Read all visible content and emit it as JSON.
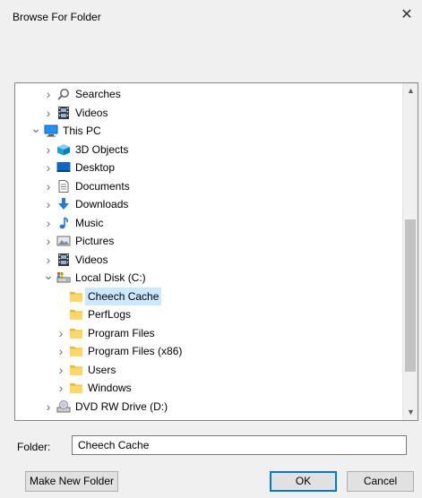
{
  "dialog": {
    "title": "Browse For Folder",
    "close_glyph": "✕"
  },
  "tree": {
    "items": [
      {
        "label": "Searches",
        "icon": "search-icon",
        "level": 1,
        "expander": "collapsed"
      },
      {
        "label": "Videos",
        "icon": "film-icon",
        "level": 1,
        "expander": "collapsed"
      },
      {
        "label": "This PC",
        "icon": "computer-icon",
        "level": 0,
        "expander": "expanded"
      },
      {
        "label": "3D Objects",
        "icon": "cube-icon",
        "level": 1,
        "expander": "collapsed"
      },
      {
        "label": "Desktop",
        "icon": "desktop-icon",
        "level": 1,
        "expander": "collapsed"
      },
      {
        "label": "Documents",
        "icon": "document-icon",
        "level": 1,
        "expander": "collapsed"
      },
      {
        "label": "Downloads",
        "icon": "download-icon",
        "level": 1,
        "expander": "collapsed"
      },
      {
        "label": "Music",
        "icon": "music-note-icon",
        "level": 1,
        "expander": "collapsed"
      },
      {
        "label": "Pictures",
        "icon": "picture-icon",
        "level": 1,
        "expander": "collapsed"
      },
      {
        "label": "Videos",
        "icon": "film-icon",
        "level": 1,
        "expander": "collapsed"
      },
      {
        "label": "Local Disk (C:)",
        "icon": "drive-icon",
        "level": 1,
        "expander": "expanded"
      },
      {
        "label": "Cheech Cache",
        "icon": "folder-icon",
        "level": 2,
        "expander": "none",
        "selected": true
      },
      {
        "label": "PerfLogs",
        "icon": "folder-icon",
        "level": 2,
        "expander": "none"
      },
      {
        "label": "Program Files",
        "icon": "folder-icon",
        "level": 2,
        "expander": "collapsed"
      },
      {
        "label": "Program Files (x86)",
        "icon": "folder-icon",
        "level": 2,
        "expander": "collapsed"
      },
      {
        "label": "Users",
        "icon": "folder-icon",
        "level": 2,
        "expander": "collapsed"
      },
      {
        "label": "Windows",
        "icon": "folder-icon",
        "level": 2,
        "expander": "collapsed"
      },
      {
        "label": "DVD RW Drive (D:)",
        "icon": "dvd-drive-icon",
        "level": 1,
        "expander": "collapsed"
      }
    ],
    "selection_color": "#cce8ff"
  },
  "folder": {
    "label": "Folder:",
    "value": "Cheech Cache"
  },
  "buttons": {
    "make_new_folder": "Make New Folder",
    "ok": "OK",
    "cancel": "Cancel"
  },
  "colors": {
    "accent": "#0078d7",
    "folder_yellow": "#ffd768"
  }
}
